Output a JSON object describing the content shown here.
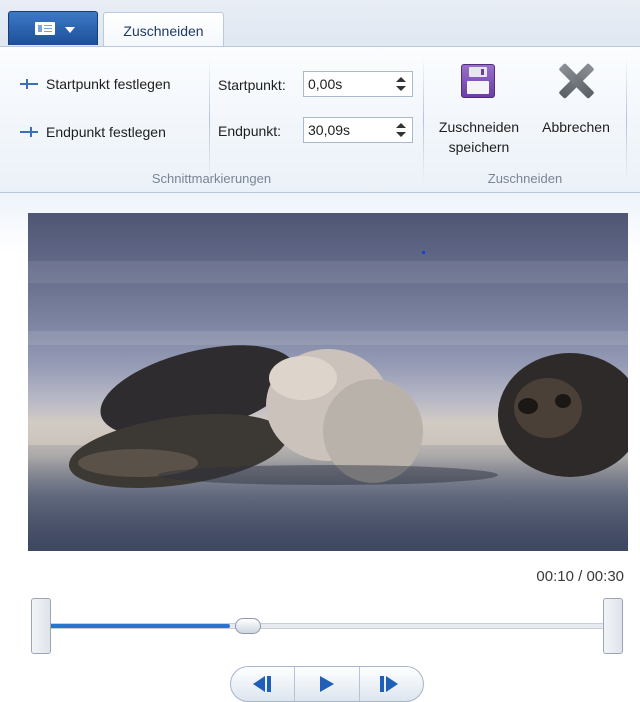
{
  "app_menu": {
    "icon": "document-icon",
    "caret": "chevron-down-icon"
  },
  "tabs": [
    {
      "label": "Zuschneiden",
      "active": true
    }
  ],
  "ribbon": {
    "marks_group": {
      "label": "Schnittmarkierungen",
      "set_start_label": "Startpunkt festlegen",
      "set_end_label": "Endpunkt festlegen",
      "start_label": "Startpunkt:",
      "start_value": "0,00s",
      "end_label": "Endpunkt:",
      "end_value": "30,09s"
    },
    "trim_group": {
      "label": "Zuschneiden",
      "save_label_line1": "Zuschneiden",
      "save_label_line2": "speichern",
      "cancel_label": "Abbrechen"
    }
  },
  "player": {
    "time_display": "00:10 / 00:30",
    "current_seconds": 10,
    "duration_seconds": 30,
    "start_marker_seconds": 0,
    "end_marker_seconds": 30.09
  },
  "controls": {
    "prev_frame": "previous-frame-icon",
    "play": "play-icon",
    "next_frame": "next-frame-icon"
  },
  "colors": {
    "accent": "#2a74cf",
    "app_menu": "#2a5ea9"
  }
}
